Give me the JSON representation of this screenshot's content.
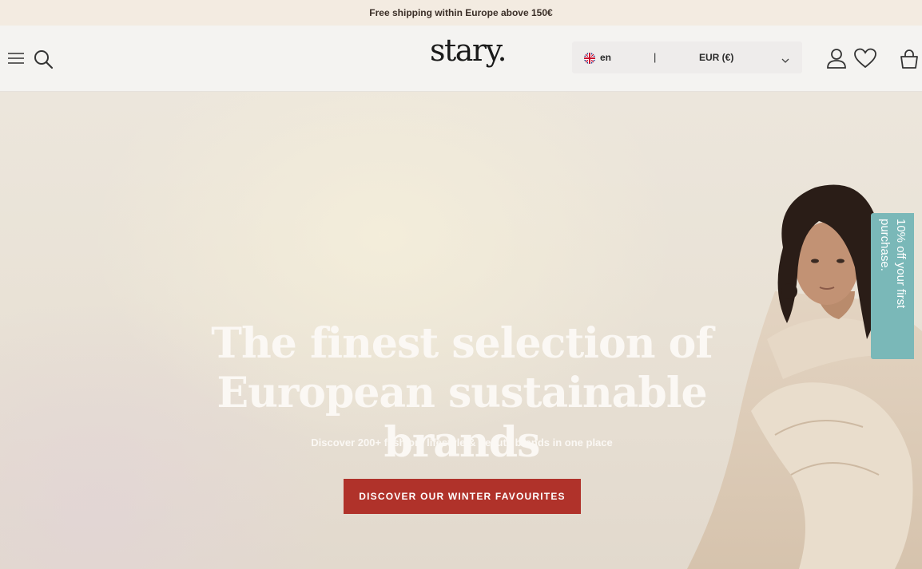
{
  "announcement": {
    "text": "Free shipping within Europe above 150€"
  },
  "header": {
    "logo": "stary.",
    "language": "en",
    "separator": "|",
    "currency": "EUR (€)"
  },
  "icons": {
    "menu": "hamburger-menu-icon",
    "search": "search-icon",
    "flag": "uk-flag-icon",
    "chevron": "chevron-down-icon",
    "account": "account-icon",
    "wishlist": "heart-icon",
    "cart": "shopping-bag-icon"
  },
  "hero": {
    "headline_line1": "The finest selection of",
    "headline_line2": "European sustainable brands",
    "subheadline": "Discover 200+ fashion, lifestyle & beauty brands in one place",
    "cta_label": "DISCOVER OUR WINTER FAVOURITES"
  },
  "promo": {
    "text": "10% off your first purchase."
  },
  "colors": {
    "announcement_bg": "#f3ebe1",
    "header_bg": "#f4f3f1",
    "cta_bg": "#b0322a",
    "promo_bg": "#7ab8b8"
  }
}
